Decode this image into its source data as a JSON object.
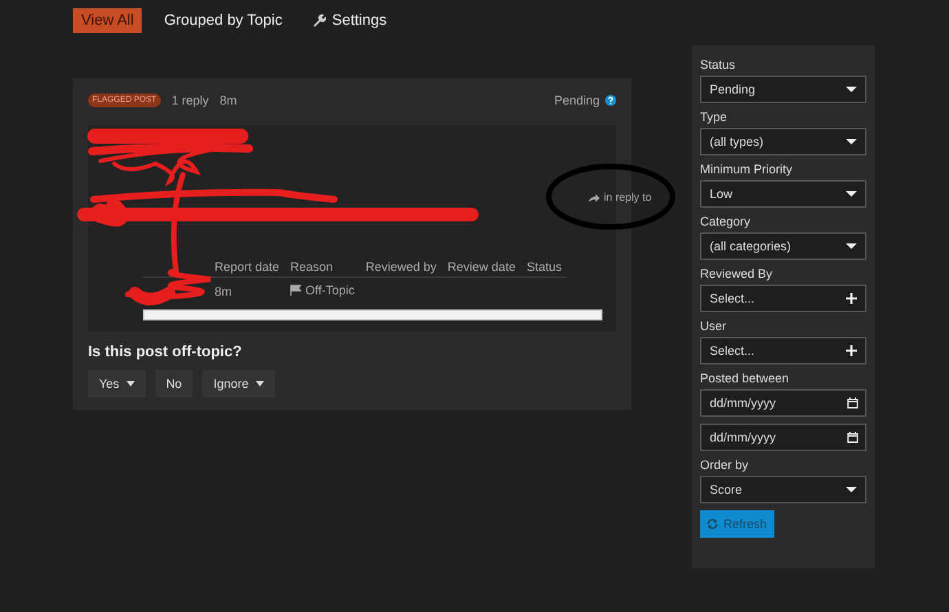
{
  "nav": [
    {
      "label": "View All",
      "selected": true,
      "kind": "plain"
    },
    {
      "label": "Grouped by Topic",
      "selected": false,
      "kind": "plain"
    },
    {
      "label": "Settings",
      "selected": false,
      "kind": "settings"
    }
  ],
  "post": {
    "badge": "FLAGGED POST",
    "replies": "1 reply",
    "age": "8m",
    "status": "Pending",
    "reply_link": "in reply to",
    "table": {
      "columns": [
        "Report date",
        "Reason",
        "Reviewed by",
        "Review date",
        "Status"
      ],
      "rows": [
        {
          "report_date": "8m",
          "reason": "Off-Topic"
        }
      ]
    }
  },
  "question": "Is this post off-topic?",
  "actions": [
    {
      "label": "Yes",
      "dropdown": true
    },
    {
      "label": "No",
      "dropdown": false
    },
    {
      "label": "Ignore",
      "dropdown": true
    }
  ],
  "filters": [
    {
      "label": "Status",
      "kind": "select",
      "value": "Pending"
    },
    {
      "label": "Type",
      "kind": "select",
      "value": "(all types)"
    },
    {
      "label": "Minimum Priority",
      "kind": "select",
      "value": "Low"
    },
    {
      "label": "Category",
      "kind": "select",
      "value": "(all categories)"
    },
    {
      "label": "Reviewed By",
      "kind": "picker",
      "value": "Select..."
    },
    {
      "label": "User",
      "kind": "picker",
      "value": "Select..."
    },
    {
      "label": "Posted between",
      "kind": "date",
      "placeholder": "dd/mm/yyyy"
    },
    {
      "kind": "date",
      "placeholder": "dd/mm/yyyy"
    },
    {
      "label": "Order by",
      "kind": "select",
      "value": "Score"
    }
  ],
  "refresh": "Refresh"
}
